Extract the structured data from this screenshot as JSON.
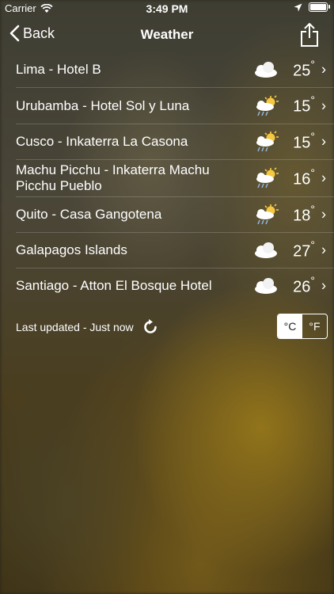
{
  "status_bar": {
    "carrier": "Carrier",
    "time": "3:49 PM"
  },
  "nav": {
    "back_label": "Back",
    "title": "Weather"
  },
  "locations": [
    {
      "name": "Lima - Hotel B",
      "icon": "partly-cloudy-icon",
      "temp": "25"
    },
    {
      "name": "Urubamba - Hotel Sol y Luna",
      "icon": "sun-rain-icon",
      "temp": "15"
    },
    {
      "name": "Cusco - Inkaterra La Casona",
      "icon": "sun-rain-icon",
      "temp": "15"
    },
    {
      "name": "Machu Picchu - Inkaterra Machu Picchu Pueblo",
      "icon": "sun-rain-icon",
      "temp": "16"
    },
    {
      "name": "Quito - Casa Gangotena",
      "icon": "sun-rain-icon",
      "temp": "18"
    },
    {
      "name": "Galapagos Islands",
      "icon": "partly-cloudy-icon",
      "temp": "27"
    },
    {
      "name": "Santiago - Atton El Bosque Hotel",
      "icon": "partly-cloudy-icon",
      "temp": "26"
    }
  ],
  "degree_symbol": "°",
  "footer": {
    "updated": "Last updated - Just now",
    "unit_c": "°C",
    "unit_f": "°F",
    "selected_unit": "°C"
  },
  "colors": {
    "text": "#ffffff",
    "sun": "#f5c842",
    "cloud": "#ffffff",
    "rain": "#8fb3d9"
  }
}
